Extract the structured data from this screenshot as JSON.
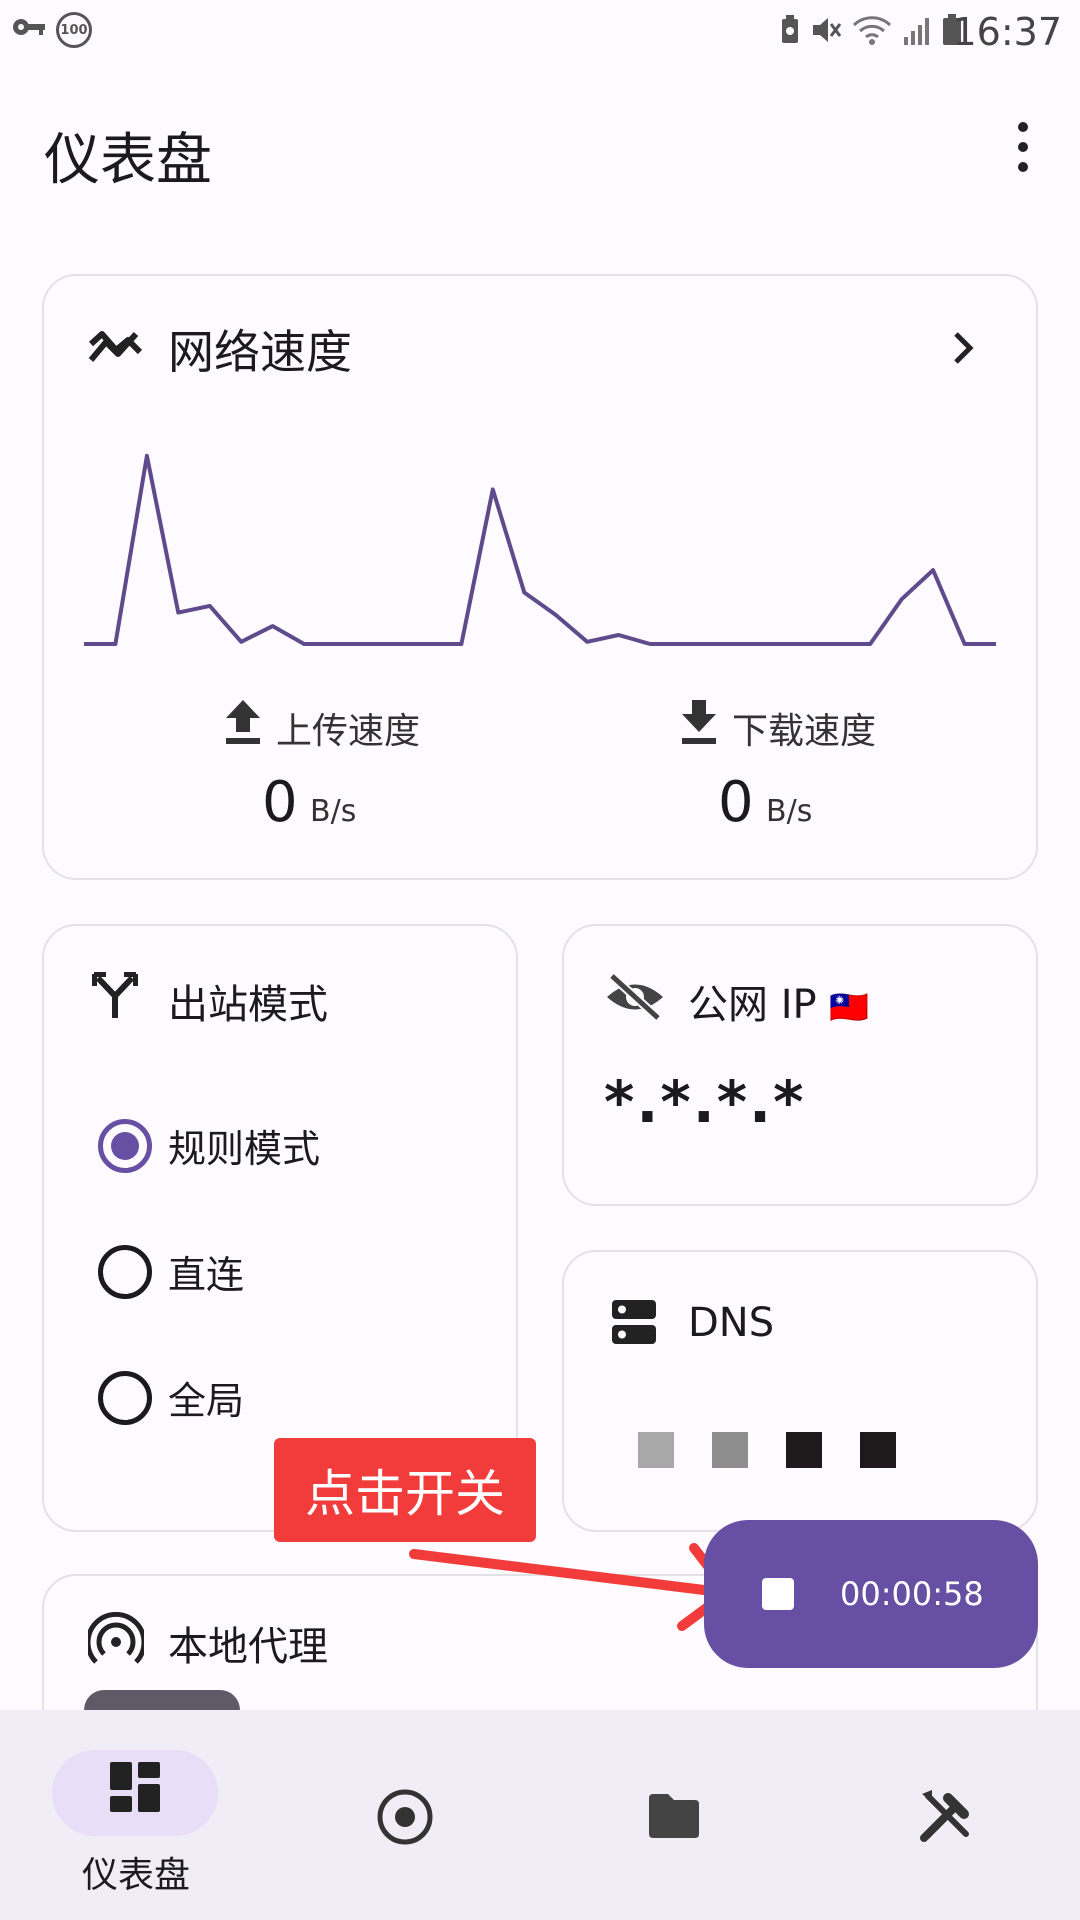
{
  "status_bar": {
    "time": "16:37",
    "battery_badge": "100",
    "icons": [
      "key-icon",
      "battery-saver-icon",
      "mute-icon",
      "wifi-icon",
      "signal-icon",
      "battery-icon"
    ]
  },
  "app_bar": {
    "title": "仪表盘",
    "menu_icon": "more-vert-icon"
  },
  "network_speed": {
    "title": "网络速度",
    "icon": "trending-icon",
    "upload": {
      "label": "上传速度",
      "value": "0",
      "unit": "B/s"
    },
    "download": {
      "label": "下载速度",
      "value": "0",
      "unit": "B/s"
    },
    "chart_data": {
      "type": "line",
      "x": [
        0,
        1,
        2,
        3,
        4,
        5,
        6,
        7,
        8,
        9,
        10,
        11,
        12,
        13,
        14,
        15,
        16,
        17,
        18,
        19,
        20,
        21,
        22,
        23,
        24,
        25,
        26,
        27,
        28,
        29
      ],
      "values": [
        0,
        0,
        0.84,
        0.14,
        0.17,
        0.01,
        0.08,
        0,
        0,
        0,
        0,
        0,
        0,
        0.69,
        0.23,
        0.13,
        0.01,
        0.04,
        0,
        0,
        0,
        0,
        0,
        0,
        0,
        0,
        0.2,
        0.33,
        0,
        0
      ],
      "color": "#5f4b8b"
    }
  },
  "outbound": {
    "title": "出站模式",
    "icon": "call-split-icon",
    "options": [
      {
        "label": "规则模式",
        "selected": true
      },
      {
        "label": "直连",
        "selected": false
      },
      {
        "label": "全局",
        "selected": false
      }
    ]
  },
  "public_ip": {
    "title": "公网 IP",
    "flag": "🇹🇼",
    "icon": "visibility-off-icon",
    "value": "*.*.*.*"
  },
  "dns": {
    "title": "DNS",
    "icon": "dns-icon",
    "blocks": [
      "#a8a8a8",
      "#8e8e8e",
      "#1e1a1b",
      "#1e1a1b"
    ]
  },
  "local_proxy": {
    "title": "本地代理",
    "icon": "hotspot-icon"
  },
  "annotation": {
    "text": "点击开关",
    "color": "#f23c3c"
  },
  "fab": {
    "time": "00:00:58",
    "icon": "stop-icon",
    "color": "#6750a4"
  },
  "bottom_nav": {
    "items": [
      {
        "label": "仪表盘",
        "icon": "dashboard-icon",
        "selected": true
      },
      {
        "label": "",
        "icon": "radio-target-icon",
        "selected": false
      },
      {
        "label": "",
        "icon": "folder-icon",
        "selected": false
      },
      {
        "label": "",
        "icon": "tools-icon",
        "selected": false
      }
    ]
  }
}
